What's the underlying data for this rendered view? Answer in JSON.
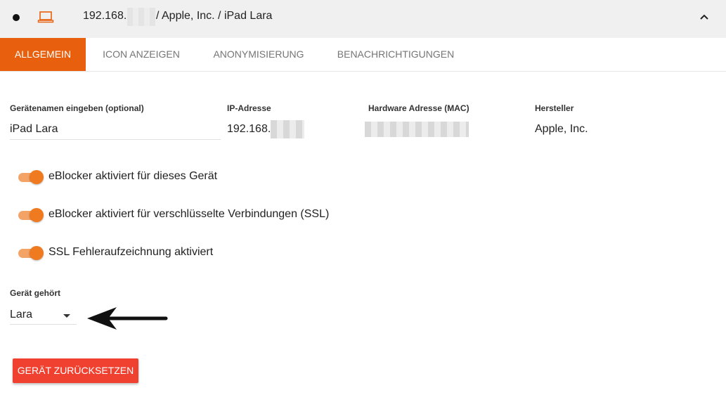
{
  "header": {
    "ip_prefix": "192.168.",
    "breadcrumb_rest": "/ Apple, Inc. / iPad Lara",
    "status_icon": "dot-icon",
    "device_icon": "laptop-icon",
    "collapse_icon": "chevron-up-icon"
  },
  "tabs": [
    {
      "label": "ALLGEMEIN",
      "active": true
    },
    {
      "label": "ICON ANZEIGEN",
      "active": false
    },
    {
      "label": "ANONYMISIERUNG",
      "active": false
    },
    {
      "label": "BENACHRICHTIGUNGEN",
      "active": false
    }
  ],
  "fields": {
    "device_name": {
      "label": "Gerätenamen eingeben (optional)",
      "value": "iPad Lara"
    },
    "ip": {
      "label": "IP-Adresse",
      "value": "192.168."
    },
    "mac": {
      "label": "Hardware Adresse (MAC)"
    },
    "vendor": {
      "label": "Hersteller",
      "value": "Apple, Inc."
    }
  },
  "toggles": [
    {
      "label": "eBlocker aktiviert für dieses Gerät",
      "on": true
    },
    {
      "label": "eBlocker aktiviert für verschlüsselte Verbindungen (SSL)",
      "on": true
    },
    {
      "label": "SSL Fehleraufzeichnung aktiviert",
      "on": true
    }
  ],
  "owner": {
    "label": "Gerät gehört",
    "value": "Lara"
  },
  "reset_button": {
    "label": "GERÄT ZURÜCKSETZEN"
  },
  "colors": {
    "accent": "#e8600e",
    "toggle_on": "#f07a1f",
    "danger": "#f0402f"
  }
}
